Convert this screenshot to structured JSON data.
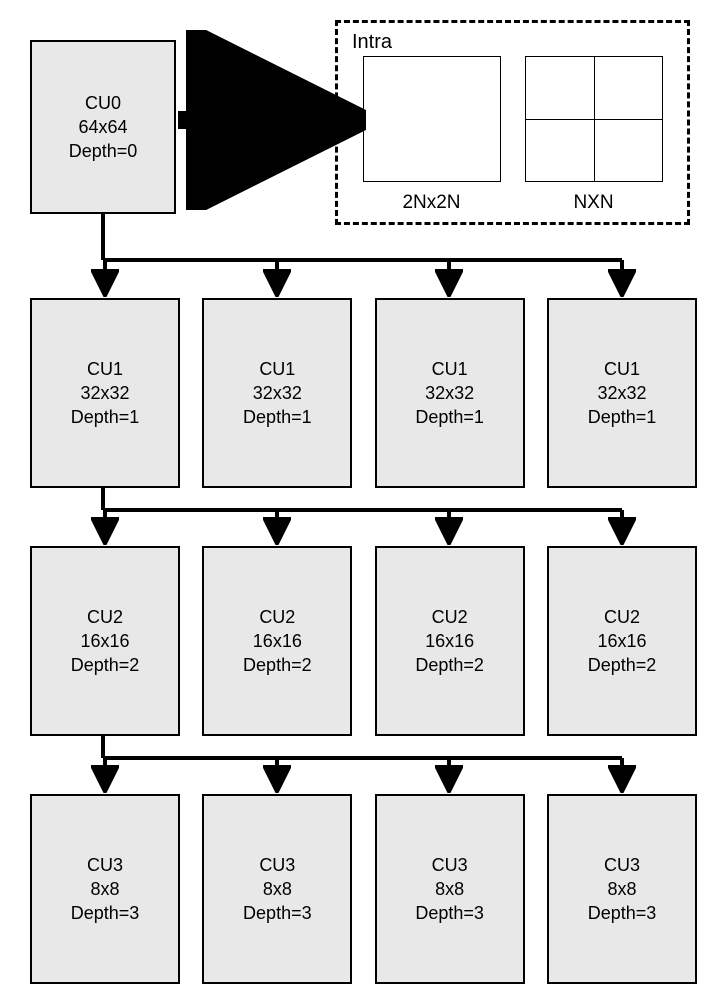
{
  "intra": {
    "title": "Intra",
    "mode2N": "2Nx2N",
    "modeN": "NXN"
  },
  "root": {
    "name": "CU0",
    "size": "64x64",
    "depth": "Depth=0"
  },
  "rows": [
    {
      "nodes": [
        {
          "name": "CU1",
          "size": "32x32",
          "depth": "Depth=1"
        },
        {
          "name": "CU1",
          "size": "32x32",
          "depth": "Depth=1"
        },
        {
          "name": "CU1",
          "size": "32x32",
          "depth": "Depth=1"
        },
        {
          "name": "CU1",
          "size": "32x32",
          "depth": "Depth=1"
        }
      ]
    },
    {
      "nodes": [
        {
          "name": "CU2",
          "size": "16x16",
          "depth": "Depth=2"
        },
        {
          "name": "CU2",
          "size": "16x16",
          "depth": "Depth=2"
        },
        {
          "name": "CU2",
          "size": "16x16",
          "depth": "Depth=2"
        },
        {
          "name": "CU2",
          "size": "16x16",
          "depth": "Depth=2"
        }
      ]
    },
    {
      "nodes": [
        {
          "name": "CU3",
          "size": "8x8",
          "depth": "Depth=3"
        },
        {
          "name": "CU3",
          "size": "8x8",
          "depth": "Depth=3"
        },
        {
          "name": "CU3",
          "size": "8x8",
          "depth": "Depth=3"
        },
        {
          "name": "CU3",
          "size": "8x8",
          "depth": "Depth=3"
        }
      ]
    }
  ]
}
